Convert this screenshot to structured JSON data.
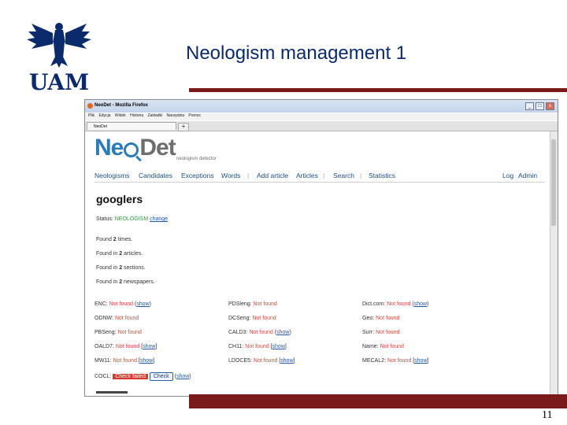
{
  "slide": {
    "title": "Neologism management 1",
    "page_number": "11",
    "logo_text": "UAM",
    "accent_color": "#7a1a1a",
    "title_color": "#0b2a6b"
  },
  "browser": {
    "window_title": "NeoDet - Mozilla Firefox",
    "menu": [
      "Plik",
      "Edycja",
      "Widok",
      "Historia",
      "Zakładki",
      "Narzędzia",
      "Pomoc"
    ],
    "tab_label": "NeoDet",
    "new_tab": "+",
    "window_buttons": [
      "_",
      "□",
      "x"
    ]
  },
  "app": {
    "brand_ne": "Ne",
    "brand_det": "Det",
    "tagline": "neologism detector",
    "nav": [
      "Neologisms",
      "Candidates",
      "Exceptions",
      "Words",
      "|",
      "Add article",
      "Articles",
      "|",
      "Search",
      "|",
      "Statistics",
      "Log",
      "Admin"
    ],
    "word": "googlers",
    "status_label": "Status:",
    "status_value": "NEOLOGISM",
    "status_action": "change",
    "facts": [
      {
        "pre": "Found ",
        "num": "2",
        "post": " times."
      },
      {
        "pre": "Found in ",
        "num": "2",
        "post": " articles."
      },
      {
        "pre": "Found in ",
        "num": "2",
        "post": " sections."
      },
      {
        "pre": "Found in ",
        "num": "2",
        "post": " newspapers."
      }
    ],
    "dictionaries": [
      {
        "name": "ENC:",
        "result": "Not found",
        "show": "show",
        "style": "paren"
      },
      {
        "name": "PDSleng:",
        "result": "Not found",
        "show": "",
        "style": "none"
      },
      {
        "name": "Dict.com:",
        "result": "Not found",
        "show": "show",
        "style": "paren"
      },
      {
        "name": "ODNW:",
        "result": "Not found",
        "show": "",
        "style": "none"
      },
      {
        "name": "DCSeng:",
        "result": "Not found",
        "show": "",
        "style": "none"
      },
      {
        "name": "Geo:",
        "result": "Not found",
        "show": "",
        "style": "none"
      },
      {
        "name": "PBSeng:",
        "result": "Not found",
        "show": "",
        "style": "none"
      },
      {
        "name": "CALD3:",
        "result": "Not found",
        "show": "show",
        "style": "paren"
      },
      {
        "name": "Surr:",
        "result": "Not found",
        "show": "",
        "style": "none"
      },
      {
        "name": "OALD7:",
        "result": "Not found",
        "show": "show",
        "style": "bracket"
      },
      {
        "name": "CH11:",
        "result": "Not found",
        "show": "show",
        "style": "bracket"
      },
      {
        "name": "Name:",
        "result": "Not found",
        "show": "",
        "style": "none"
      },
      {
        "name": "MW11:",
        "result": "Not found",
        "show": "show",
        "style": "bracket"
      },
      {
        "name": "LDOCE5:",
        "result": "Not found",
        "show": "show",
        "style": "bracket"
      },
      {
        "name": "MECAL2:",
        "result": "Not found",
        "show": "show",
        "style": "bracket"
      },
      {
        "name": "COCL:",
        "result": "Check failed",
        "show": "show",
        "style": "paren",
        "button": "Check"
      }
    ],
    "colors": {
      "link": "#2359a8",
      "not_found": "#e0453a",
      "neologism": "#2a9d3a",
      "brand": "#2a7bb8"
    }
  }
}
